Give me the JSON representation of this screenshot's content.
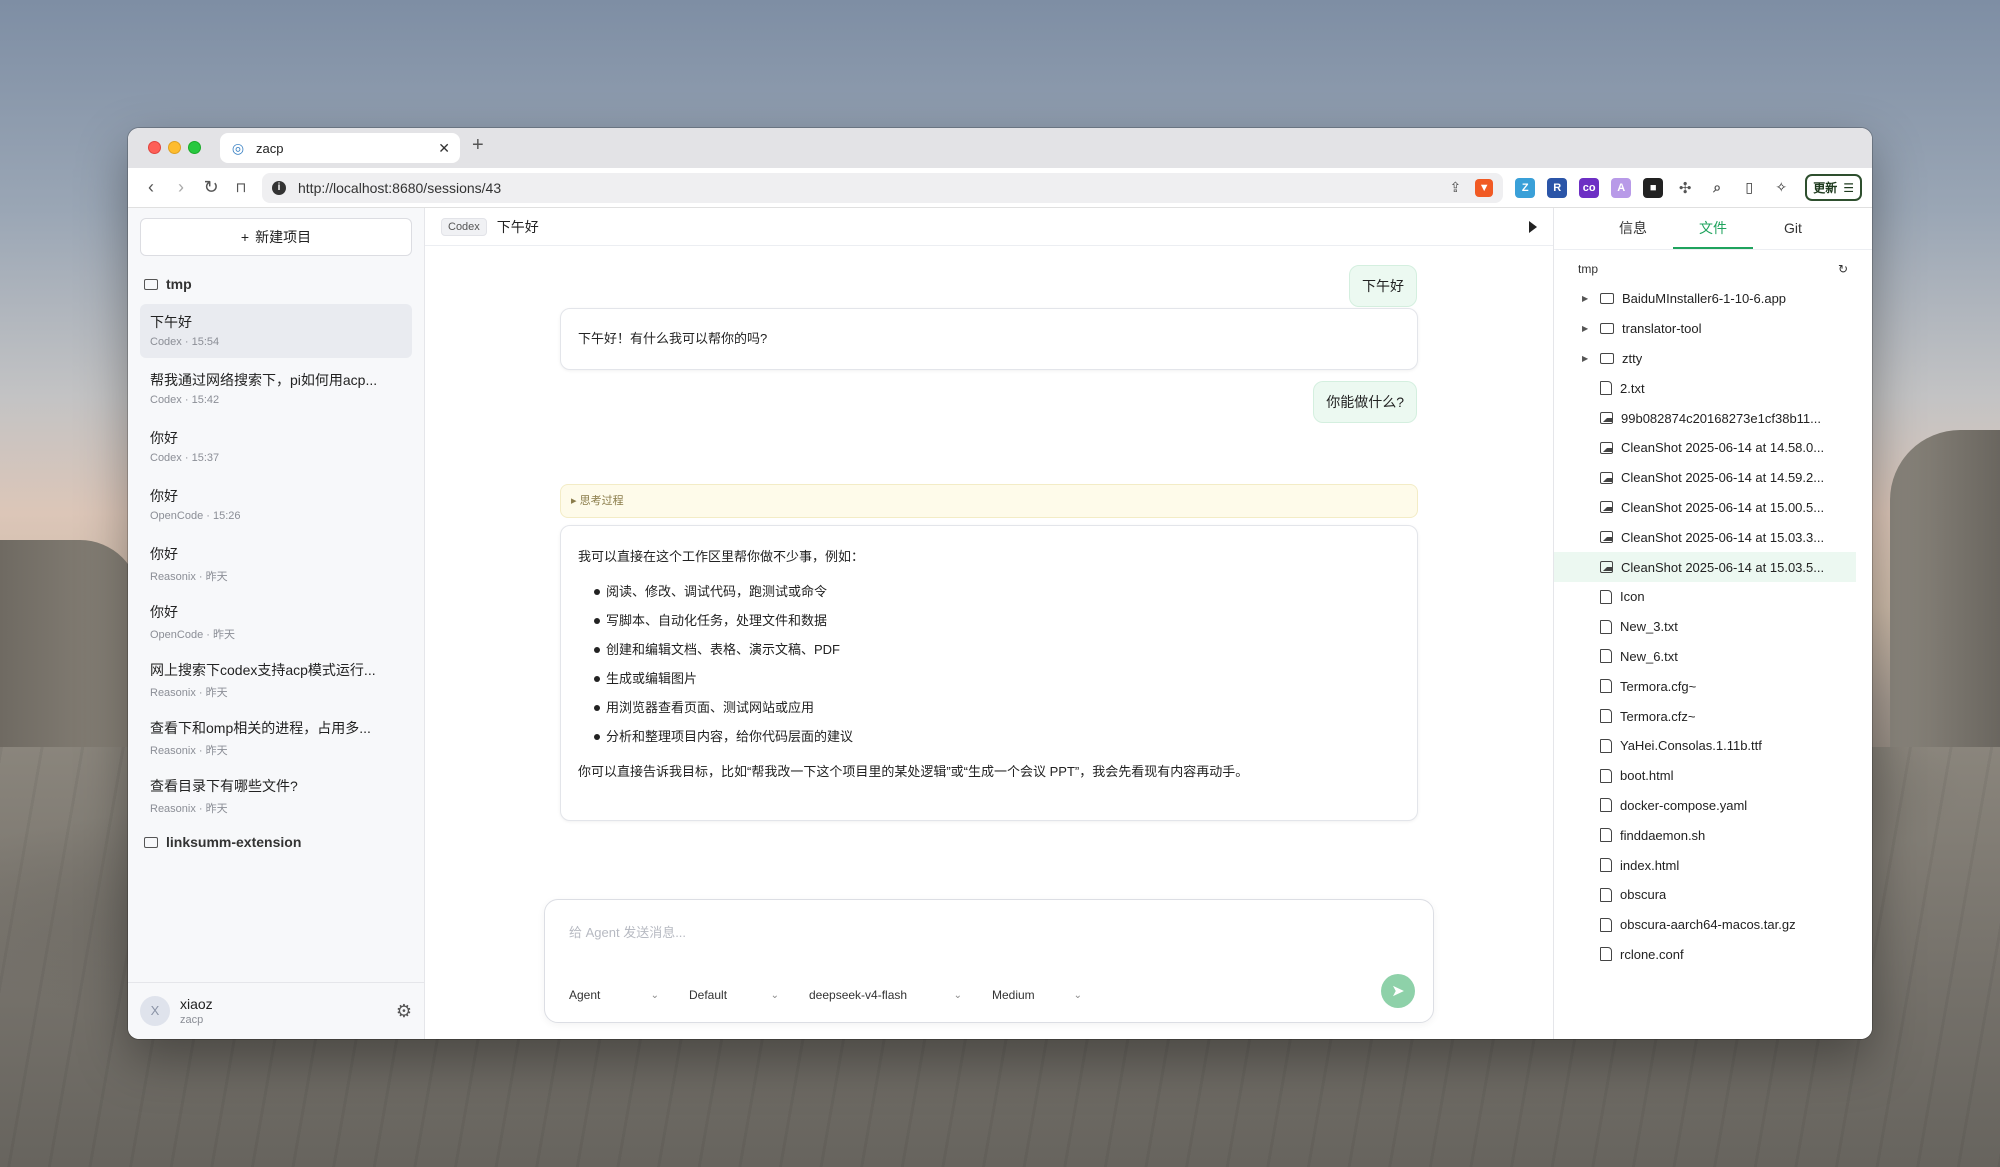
{
  "browser": {
    "tab_title": "zacp",
    "url": "http://localhost:8680/sessions/43",
    "update_label": "更新"
  },
  "sidebar": {
    "new_project_label": "新建项目",
    "projects": [
      {
        "name": "tmp"
      },
      {
        "name": "linksumm-extension"
      }
    ],
    "sessions": [
      {
        "title": "下午好",
        "agent": "Codex",
        "time": "15:54"
      },
      {
        "title": "帮我通过网络搜索下，pi如何用acp...",
        "agent": "Codex",
        "time": "15:42"
      },
      {
        "title": "你好",
        "agent": "Codex",
        "time": "15:37"
      },
      {
        "title": "你好",
        "agent": "OpenCode",
        "time": "15:26"
      },
      {
        "title": "你好",
        "agent": "Reasonix",
        "time": "昨天"
      },
      {
        "title": "你好",
        "agent": "OpenCode",
        "time": "昨天"
      },
      {
        "title": "网上搜索下codex支持acp模式运行...",
        "agent": "Reasonix",
        "time": "昨天"
      },
      {
        "title": "查看下和omp相关的进程，占用多...",
        "agent": "Reasonix",
        "time": "昨天"
      },
      {
        "title": "查看目录下有哪些文件?",
        "agent": "Reasonix",
        "time": "昨天"
      }
    ],
    "meta_sep": "·",
    "user": {
      "initial": "X",
      "name": "xiaoz",
      "sub": "zacp"
    }
  },
  "chat": {
    "agent_badge": "Codex",
    "title": "下午好",
    "messages": {
      "user1": "下午好",
      "agent1": "下午好！有什么我可以帮你的吗?",
      "user2": "你能做什么?",
      "think": "▸ 思考过程",
      "agent2_intro": "我可以直接在这个工作区里帮你做不少事，例如：",
      "agent2_items": [
        "阅读、修改、调试代码，跑测试或命令",
        "写脚本、自动化任务，处理文件和数据",
        "创建和编辑文档、表格、演示文稿、PDF",
        "生成或编辑图片",
        "用浏览器查看页面、测试网站或应用",
        "分析和整理项目内容，给你代码层面的建议"
      ],
      "agent2_outro": "你可以直接告诉我目标，比如“帮我改一下这个项目里的某处逻辑”或“生成一个会议 PPT”，我会先看现有内容再动手。"
    },
    "composer": {
      "placeholder": "给 Agent 发送消息...",
      "mode": "Agent",
      "profile": "Default",
      "model": "deepseek-v4-flash",
      "effort": "Medium"
    }
  },
  "files": {
    "tabs": [
      "信息",
      "文件",
      "Git"
    ],
    "active_tab": "文件",
    "root": "tmp",
    "entries": [
      {
        "name": "BaiduMInstaller6-1-10-6.app",
        "type": "folder"
      },
      {
        "name": "translator-tool",
        "type": "folder"
      },
      {
        "name": "ztty",
        "type": "folder"
      },
      {
        "name": "2.txt",
        "type": "file"
      },
      {
        "name": "99b082874c20168273e1cf38b11...",
        "type": "image"
      },
      {
        "name": "CleanShot 2025-06-14 at 14.58.0...",
        "type": "image"
      },
      {
        "name": "CleanShot 2025-06-14 at 14.59.2...",
        "type": "image"
      },
      {
        "name": "CleanShot 2025-06-14 at 15.00.5...",
        "type": "image"
      },
      {
        "name": "CleanShot 2025-06-14 at 15.03.3...",
        "type": "image"
      },
      {
        "name": "CleanShot 2025-06-14 at 15.03.5...",
        "type": "image"
      },
      {
        "name": "Icon",
        "type": "file"
      },
      {
        "name": "New_3.txt",
        "type": "file"
      },
      {
        "name": "New_6.txt",
        "type": "file"
      },
      {
        "name": "Termora.cfg~",
        "type": "file"
      },
      {
        "name": "Termora.cfz~",
        "type": "file"
      },
      {
        "name": "YaHei.Consolas.1.11b.ttf",
        "type": "file"
      },
      {
        "name": "boot.html",
        "type": "file"
      },
      {
        "name": "docker-compose.yaml",
        "type": "file"
      },
      {
        "name": "finddaemon.sh",
        "type": "file"
      },
      {
        "name": "index.html",
        "type": "file"
      },
      {
        "name": "obscura",
        "type": "file"
      },
      {
        "name": "obscura-aarch64-macos.tar.gz",
        "type": "file"
      },
      {
        "name": "rclone.conf",
        "type": "file"
      }
    ]
  }
}
